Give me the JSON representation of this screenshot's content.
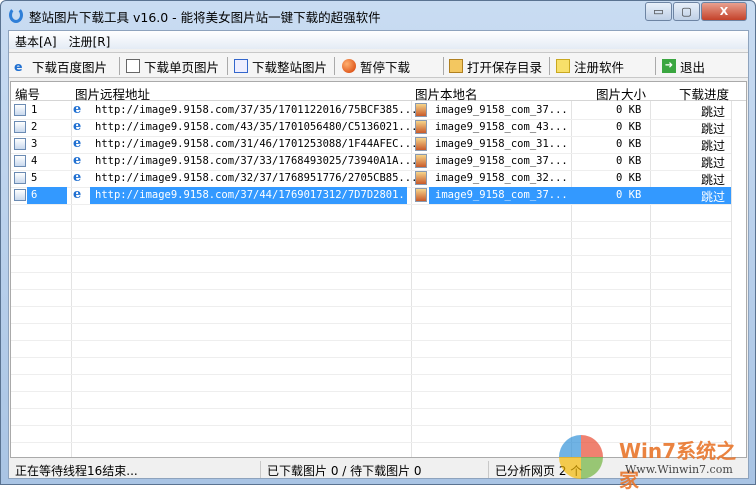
{
  "window": {
    "title": "整站图片下载工具 v16.0 - 能将美女图片站一键下载的超强软件",
    "minimize": "▭",
    "maximize": "▢",
    "close": "X"
  },
  "menu": [
    "基本[A]",
    "注册[R]"
  ],
  "toolbar": [
    {
      "label": "下载百度图片",
      "icon": "ie-page-icon"
    },
    {
      "label": "下载单页图片",
      "icon": "document-icon"
    },
    {
      "label": "下载整站图片",
      "icon": "site-document-icon"
    },
    {
      "label": "暂停下载",
      "icon": "red-circle-icon"
    },
    {
      "label": "打开保存目录",
      "icon": "folder-open-icon"
    },
    {
      "label": "注册软件",
      "icon": "note-icon"
    },
    {
      "label": "退出",
      "icon": "exit-arrow-icon"
    }
  ],
  "columns": [
    "编号",
    "图片远程地址",
    "图片本地名",
    "图片大小",
    "下载进度"
  ],
  "rows": [
    {
      "id": "1",
      "url": "http://image9.9158.com/37/35/1701122016/75BCF385...",
      "name": "image9_9158_com_37...",
      "size": "0 KB",
      "progress": "跳过"
    },
    {
      "id": "2",
      "url": "http://image9.9158.com/43/35/1701056480/C5136021...",
      "name": "image9_9158_com_43...",
      "size": "0 KB",
      "progress": "跳过"
    },
    {
      "id": "3",
      "url": "http://image9.9158.com/31/46/1701253088/1F44AFEC...",
      "name": "image9_9158_com_31...",
      "size": "0 KB",
      "progress": "跳过"
    },
    {
      "id": "4",
      "url": "http://image9.9158.com/37/33/1768493025/73940A1A...",
      "name": "image9_9158_com_37...",
      "size": "0 KB",
      "progress": "跳过"
    },
    {
      "id": "5",
      "url": "http://image9.9158.com/32/37/1768951776/2705CB85...",
      "name": "image9_9158_com_32...",
      "size": "0 KB",
      "progress": "跳过"
    },
    {
      "id": "6",
      "url": "http://image9.9158.com/37/44/1769017312/7D7D2801...",
      "name": "image9_9158_com_37...",
      "size": "0 KB",
      "progress": "跳过",
      "selected": true
    }
  ],
  "status": {
    "thread": "正在等待线程16结束...",
    "counts": "已下载图片 0 / 待下载图片 0",
    "pages": "已分析网页 2 个"
  },
  "watermark": {
    "brand": "Win7系统之家",
    "url": "Www.Winwin7.com"
  }
}
